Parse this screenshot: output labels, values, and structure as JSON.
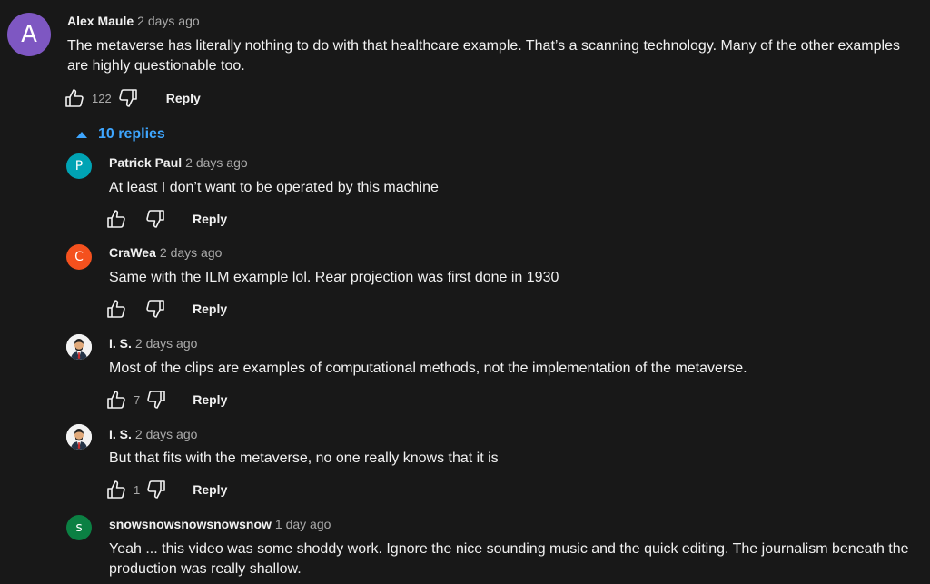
{
  "comment": {
    "avatar_letter": "A",
    "author": "Alex Maule",
    "time": "2 days ago",
    "text": "The metaverse has literally nothing to do with that healthcare example. That’s a scanning technology. Many of the other examples are highly questionable too.",
    "likes": "122",
    "reply_label": "Reply"
  },
  "replies_toggle": {
    "label": "10 replies"
  },
  "replies": [
    {
      "avatar_letter": "P",
      "avatar_color": "#00a3b4",
      "author": "Patrick Paul",
      "time": "2 days ago",
      "text": "At least I don’t want to be operated by this machine",
      "likes": "",
      "reply_label": "Reply"
    },
    {
      "avatar_letter": "C",
      "avatar_color": "#f4511e",
      "author": "CraWea",
      "time": "2 days ago",
      "text": "Same with the ILM example lol. Rear projection was first done in 1930",
      "likes": "",
      "reply_label": "Reply"
    },
    {
      "avatar_letter": "",
      "avatar_color": "#f2f2f2",
      "author": "I. S.",
      "time": "2 days ago",
      "text": "Most of the clips are examples of computational methods, not the implementation of the metaverse.",
      "likes": "7",
      "reply_label": "Reply"
    },
    {
      "avatar_letter": "",
      "avatar_color": "#f2f2f2",
      "author": "I. S.",
      "time": "2 days ago",
      "text": "But that fits with the metaverse, no one really knows that it is",
      "likes": "1",
      "reply_label": "Reply"
    },
    {
      "avatar_letter": "s",
      "avatar_color": "#0b8043",
      "author": "snowsnowsnowsnowsnow",
      "time": "1 day ago",
      "text": "Yeah ... this video was some shoddy work. Ignore the nice sounding music and the quick editing. The journalism beneath the production was really shallow.",
      "likes": "",
      "reply_label": "Reply"
    }
  ],
  "colors": {
    "background": "#181818",
    "link": "#3ea6ff",
    "main_avatar": "#7e57c2"
  }
}
